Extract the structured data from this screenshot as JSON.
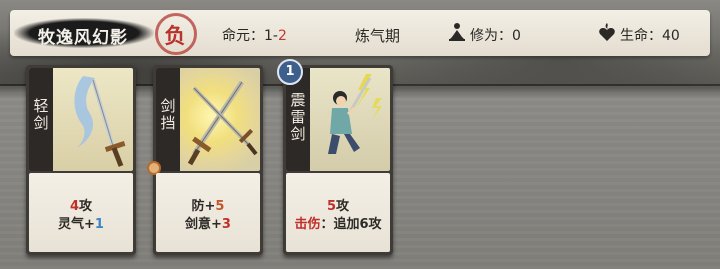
{
  "header": {
    "player_name": "牧逸风幻影",
    "defeat_seal": "负",
    "destiny_label": "命元：",
    "destiny_current": "1",
    "destiny_sep": "-",
    "destiny_max": "2",
    "realm": "炼气期",
    "cultivation_label": "修为：0",
    "hp_label": "生命：40",
    "cultivation_icon": "meditating-figure-icon",
    "hp_icon": "heart-flame-icon"
  },
  "cards": [
    {
      "name": "轻剑",
      "art_icon": "light-sword-icon",
      "line1_num": "4",
      "line1_text": "攻",
      "line2_text": "灵气+",
      "line2_num": "1"
    },
    {
      "name": "剑挡",
      "art_icon": "crossed-swords-icon",
      "line1_text": "防+",
      "line1_num": "5",
      "line2_text": "剑意+",
      "line2_num": "3"
    },
    {
      "name": "震雷剑",
      "level": "1",
      "art_icon": "thunder-swordsman-icon",
      "line1_num": "5",
      "line1_text": "攻",
      "line2_keyword": "击伤",
      "line2_text": "：追加6攻"
    }
  ],
  "colors": {
    "accent_red": "#c0302a",
    "accent_orange": "#c0582b",
    "accent_blue": "#3e84c4",
    "level_badge": "#3d5f8c"
  }
}
